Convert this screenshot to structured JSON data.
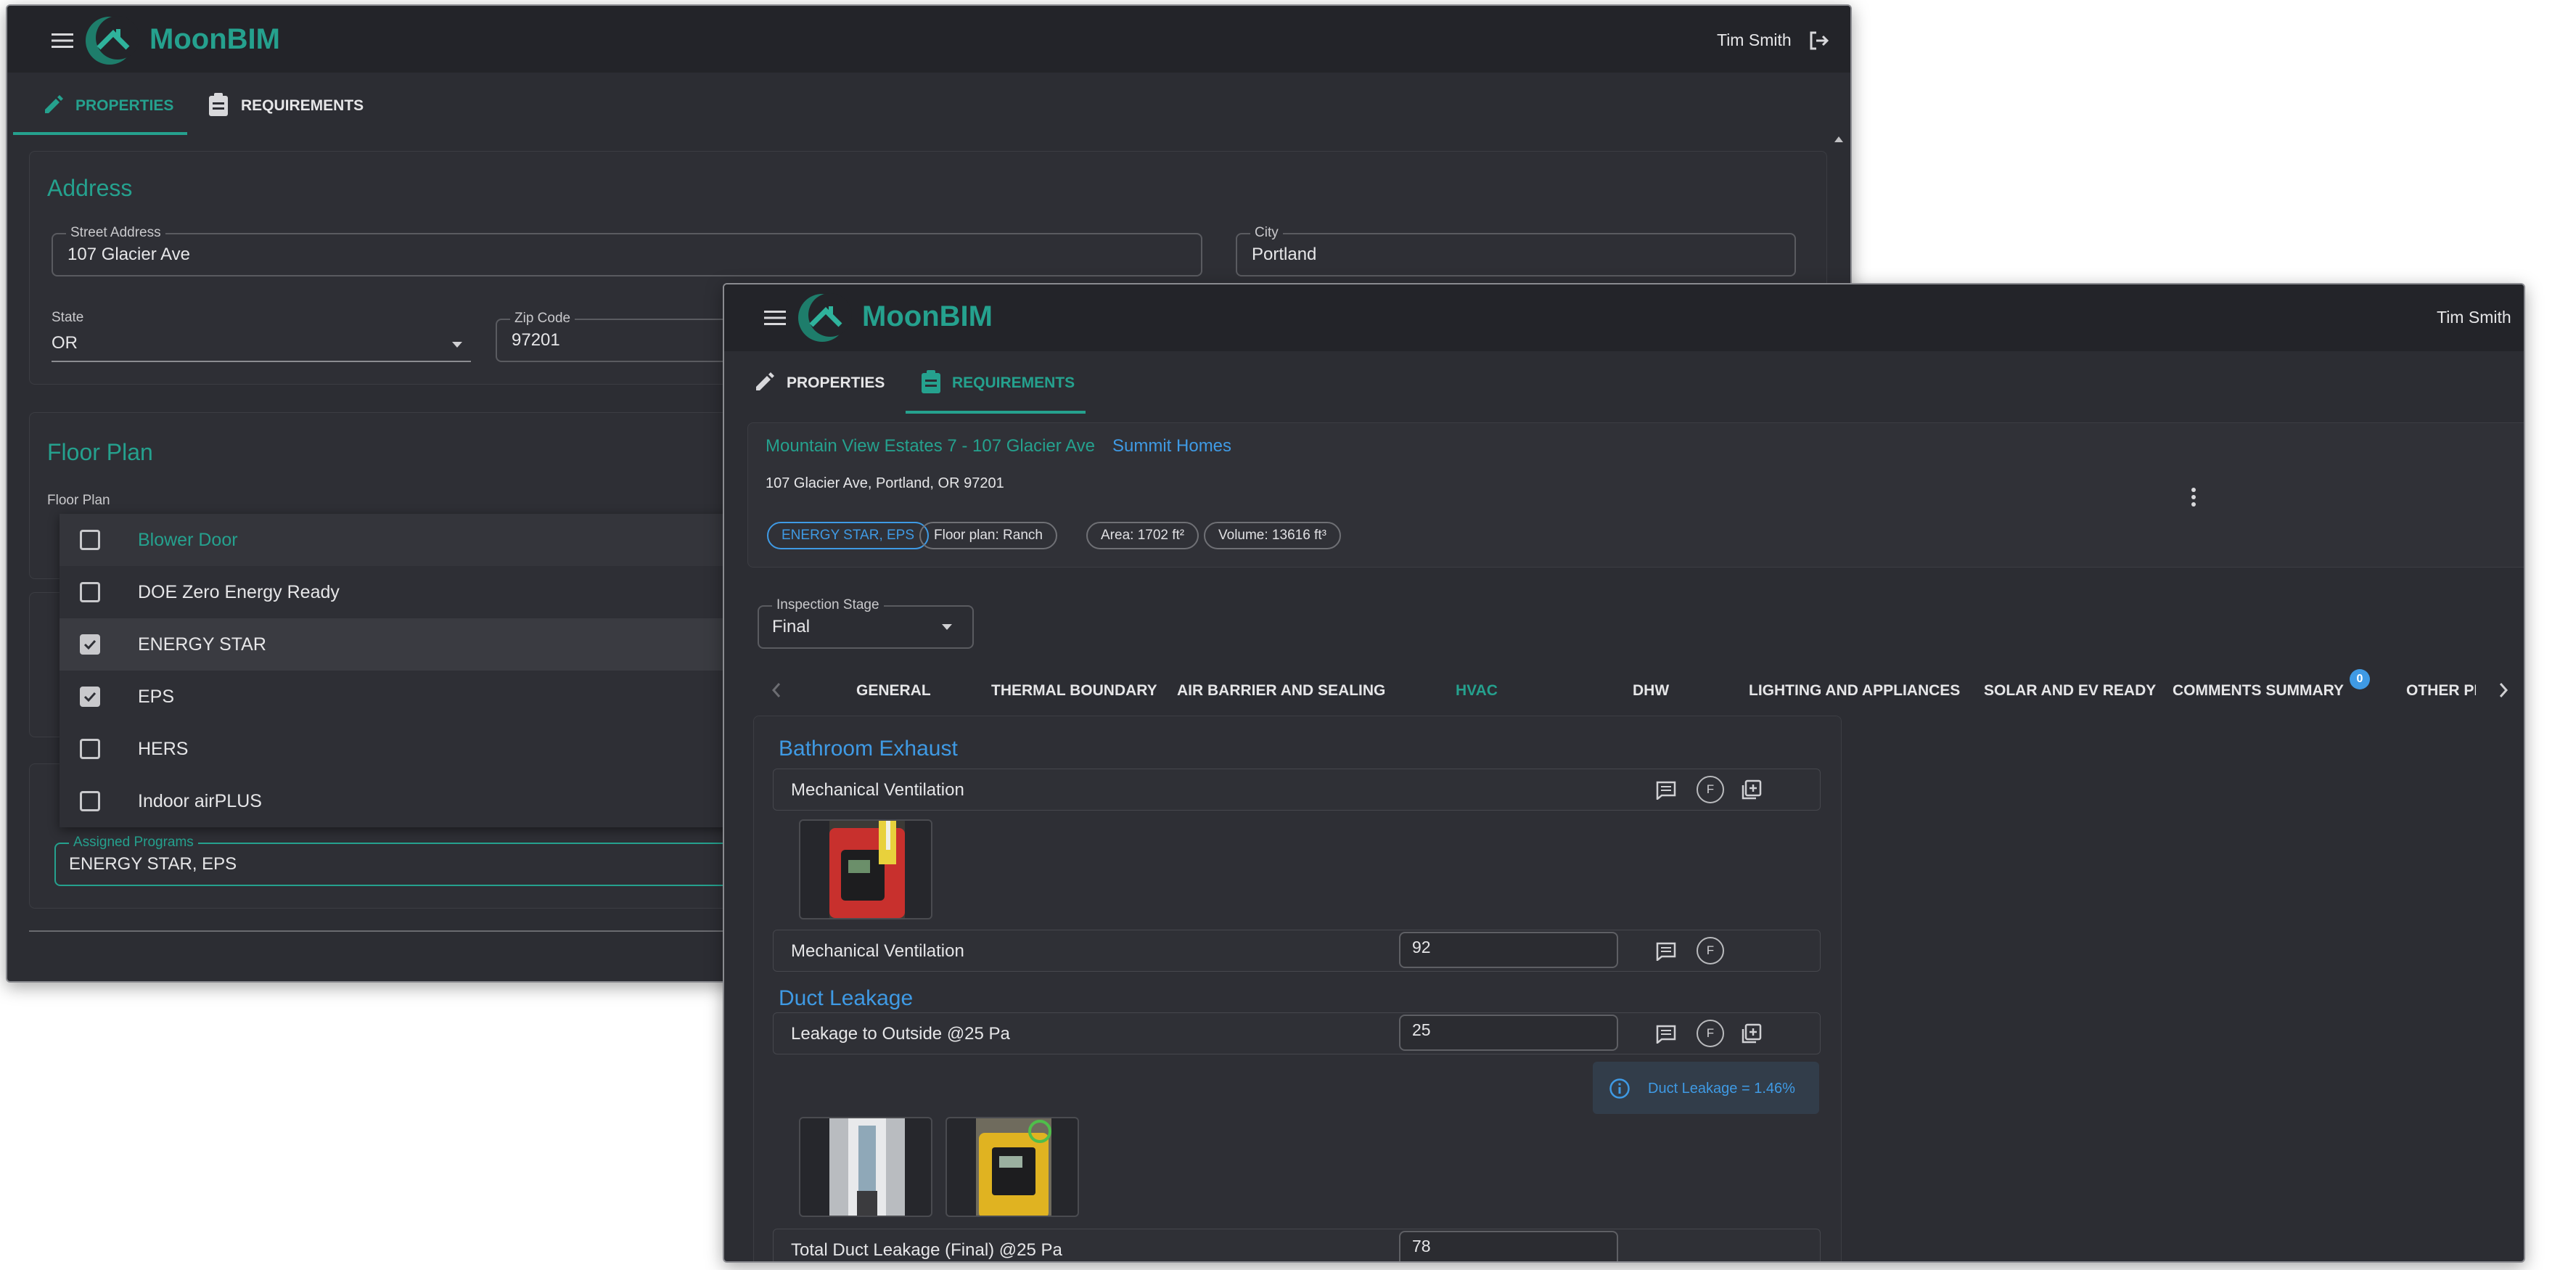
{
  "app": {
    "brand": "MoonBIM",
    "user": "Tim Smith"
  },
  "back_window": {
    "tabs": {
      "properties": "PROPERTIES",
      "requirements": "REQUIREMENTS"
    },
    "address": {
      "title": "Address",
      "street_label": "Street Address",
      "street_value": "107 Glacier Ave",
      "city_label": "City",
      "city_value": "Portland",
      "state_label": "State",
      "state_value": "OR",
      "zip_label": "Zip Code",
      "zip_value": "97201"
    },
    "floor_plan": {
      "title": "Floor Plan",
      "field_label": "Floor Plan"
    },
    "programs_menu": {
      "items": [
        {
          "label": "Blower Door",
          "checked": false
        },
        {
          "label": "DOE Zero Energy Ready",
          "checked": false
        },
        {
          "label": "ENERGY STAR",
          "checked": true
        },
        {
          "label": "EPS",
          "checked": true
        },
        {
          "label": "HERS",
          "checked": false
        },
        {
          "label": "Indoor airPLUS",
          "checked": false
        }
      ]
    },
    "assigned_programs": {
      "label": "Assigned Programs",
      "value": "ENERGY STAR, EPS"
    }
  },
  "front_window": {
    "tabs": {
      "properties": "PROPERTIES",
      "requirements": "REQUIREMENTS"
    },
    "project": {
      "title": "Mountain View Estates 7 - 107 Glacier Ave",
      "builder": "Summit Homes",
      "address": "107 Glacier Ave, Portland, OR 97201",
      "chips": [
        "ENERGY STAR, EPS",
        "Floor plan: Ranch",
        "Area: 1702 ft²",
        "Volume: 13616 ft³"
      ]
    },
    "inspection_stage": {
      "label": "Inspection Stage",
      "value": "Final"
    },
    "section_tabs": [
      "GENERAL",
      "THERMAL BOUNDARY",
      "AIR BARRIER AND SEALING",
      "HVAC",
      "DHW",
      "LIGHTING AND APPLIANCES",
      "SOLAR AND EV READY",
      "COMMENTS SUMMARY",
      "OTHER PI"
    ],
    "comments_badge": "0",
    "sections": {
      "bathroom_exhaust": {
        "title": "Bathroom Exhaust",
        "row1_label": "Mechanical Ventilation",
        "row2_label": "Mechanical Ventilation",
        "row2_value": "92"
      },
      "duct_leakage": {
        "title": "Duct Leakage",
        "row1_label": "Leakage to Outside @25 Pa",
        "row1_value": "25",
        "info_text": "Duct Leakage = 1.46%",
        "row2_label": "Total Duct Leakage (Final) @25 Pa",
        "row2_value": "78"
      }
    },
    "flag_letter": "F"
  }
}
